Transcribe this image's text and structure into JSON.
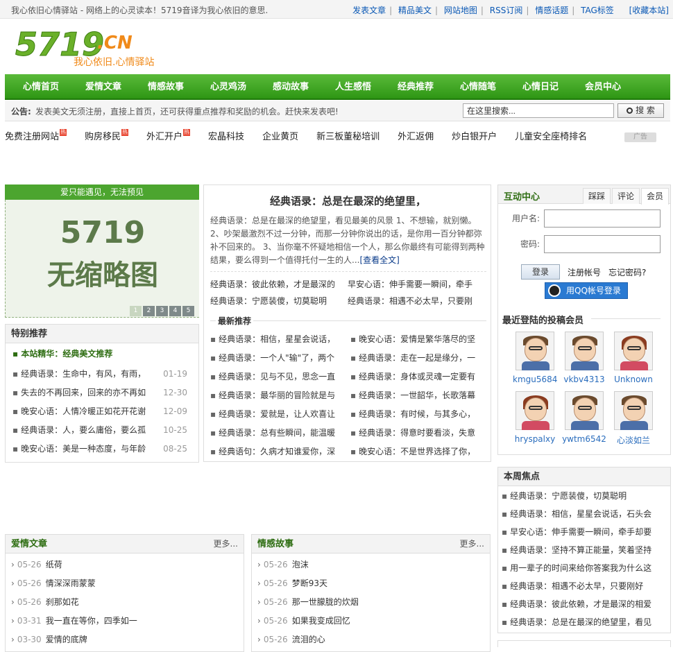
{
  "topbar": {
    "slogan": "我心依旧心情驿站 - 网络上的心灵读本！5719音译为我心依旧的意思.",
    "links": [
      "发表文章",
      "精品美文",
      "网站地图",
      "RSS订阅",
      "情感话题",
      "TAG标签"
    ],
    "bookmark": "[收藏本站]"
  },
  "logo": {
    "main": "5719",
    "suffix": ".CN",
    "tagline": "我心依旧.心情驿站"
  },
  "nav": [
    "心情首页",
    "爱情文章",
    "情感故事",
    "心灵鸡汤",
    "感动故事",
    "人生感悟",
    "经典推荐",
    "心情随笔",
    "心情日记",
    "会员中心"
  ],
  "notice": {
    "label": "公告:",
    "text": "发表美文无须注册，直接上首页，还可获得重点推荐和奖励的机会。赶快来发表吧!",
    "search_placeholder": "在这里搜索...",
    "search_button": "搜 索"
  },
  "adlinks": [
    {
      "text": "免费注册网站",
      "hot": true
    },
    {
      "text": "购房移民",
      "hot": true
    },
    {
      "text": "外汇开户",
      "hot": true
    },
    {
      "text": "宏晶科技",
      "hot": false
    },
    {
      "text": "企业黄页",
      "hot": false
    },
    {
      "text": "新三板董秘培训",
      "hot": false
    },
    {
      "text": "外汇返佣",
      "hot": false
    },
    {
      "text": "炒白银开户",
      "hot": false
    },
    {
      "text": "儿童安全座椅排名",
      "hot": false
    }
  ],
  "ad_badge_hot": "热",
  "ad_tag": "广告",
  "slideshow": {
    "title": "爱只能遇见，无法预见",
    "image_line1": "5719",
    "image_line2": "无缩略图",
    "pages": [
      "1",
      "2",
      "3",
      "4",
      "5"
    ]
  },
  "special": {
    "title": "特别推荐",
    "featured": "本站精华：经典美文推荐",
    "items": [
      {
        "text": "经典语录：生命中，有风，有雨，",
        "date": "01-19"
      },
      {
        "text": "失去的不再回来，回来的亦不再如",
        "date": "12-30"
      },
      {
        "text": "晚安心语：人情冷暖正如花开花谢",
        "date": "12-09"
      },
      {
        "text": "经典语录：人，要么庸俗，要么孤",
        "date": "10-25"
      },
      {
        "text": "晚安心语：美是一种态度，与年龄",
        "date": "08-25"
      }
    ]
  },
  "center": {
    "headline": "经典语录：总是在最深的绝望里，",
    "summary": "经典语录：总是在最深的绝望里，看见最美的风景 1、不想输，就别懒。 2、吵架最激烈不过一分钟，而那一分钟你说出的话，是你用一百分钟都弥补不回来的。 3、当你毫不怀疑地相信一个人，那么你最终有可能得到两种结果，要么得到一个值得托付一生的人...",
    "more": "[查看全文]",
    "pair_rows": [
      [
        "经典语录：彼此依赖，才是最深的",
        "早安心语：伸手需要一瞬间，牵手"
      ],
      [
        "经典语录：宁愿装傻，切莫聪明",
        "经典语录：相遇不必太早，只要刚"
      ]
    ],
    "latest_title": "最新推荐",
    "latest_left": [
      "经典语录：相信，星星会说话，",
      "经典语录：一个人\"输\"了，两个",
      "经典语录：见与不见，思念一直",
      "经典语录：最华丽的冒险就是与",
      "经典语录：爱就是，让人欢喜让",
      "经典语录：总有些瞬间，能温暖",
      "经典语句：久病才知谁爱你，深"
    ],
    "latest_right": [
      "晚安心语：爱情是繁华落尽的坚",
      "经典语录：走在一起是缘分，一",
      "经典语录：身体或灵魂一定要有",
      "经典语录：一世韶华，长歌落幕",
      "经典语录：有时候，与其多心，",
      "经典语录：得意时要看淡，失意",
      "晚安心语：不是世界选择了你，"
    ]
  },
  "interact": {
    "title": "互动中心",
    "tabs": [
      "踩踩",
      "评论",
      "会员"
    ],
    "username_label": "用户名:",
    "password_label": "密码:",
    "login_button": "登录",
    "register": "注册帐号",
    "forgot": "忘记密码?",
    "qq_login": "用QQ帐号登录",
    "recent_title": "最近登陆的投稿会员",
    "members": [
      "kmgu5684",
      "vkbv4313",
      "Unknown",
      "hryspalxy",
      "ywtm6542",
      "心淡如兰"
    ]
  },
  "focus": {
    "title": "本周焦点",
    "items": [
      "经典语录：宁愿装傻，切莫聪明",
      "经典语录：相信，星星会说话，石头会",
      "早安心语：伸手需要一瞬间，牵手却要",
      "经典语录：坚持不算正能量，笑着坚持",
      "用一辈子的时间来给你答案我为什么这",
      "经典语录：相遇不必太早，只要刚好",
      "经典语录：彼此依赖，才是最深的相爱",
      "经典语录：总是在最深的绝望里，看见"
    ]
  },
  "love": {
    "title": "爱情文章",
    "more": "更多...",
    "items": [
      {
        "date": "05-26",
        "text": "纸荷"
      },
      {
        "date": "05-26",
        "text": "情深深雨蒙蒙"
      },
      {
        "date": "05-26",
        "text": "刹那如花"
      },
      {
        "date": "03-31",
        "text": "我一直在等你，四季如一"
      },
      {
        "date": "03-30",
        "text": "爱情的底牌"
      }
    ]
  },
  "emotion": {
    "title": "情感故事",
    "more": "更多...",
    "items": [
      {
        "date": "05-26",
        "text": "泡沫"
      },
      {
        "date": "05-26",
        "text": "梦断93天"
      },
      {
        "date": "05-26",
        "text": "那一世朦胧的炊烟"
      },
      {
        "date": "05-26",
        "text": "如果我变成回忆"
      },
      {
        "date": "05-26",
        "text": "流泪的心"
      }
    ]
  }
}
